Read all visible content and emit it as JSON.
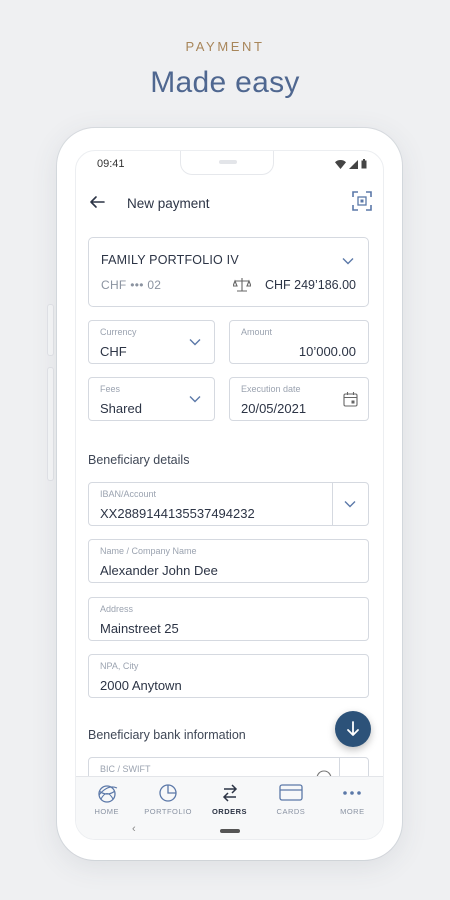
{
  "promo": {
    "eyebrow": "PAYMENT",
    "headline": "Made easy"
  },
  "status_bar": {
    "time": "09:41",
    "icons": [
      "wifi-icon",
      "signal-icon",
      "battery-icon"
    ]
  },
  "header": {
    "title": "New payment",
    "back_icon": "arrow-left-icon",
    "scan_icon": "qr-scan-icon"
  },
  "portfolio": {
    "name": "FAMILY PORTFOLIO IV",
    "account": "CHF ••• 02",
    "balance": "CHF 249’186.00",
    "balance_icon": "scale-icon"
  },
  "form": {
    "currency": {
      "label": "Currency",
      "value": "CHF"
    },
    "amount": {
      "label": "Amount",
      "value": "10’000.00"
    },
    "fees": {
      "label": "Fees",
      "value": "Shared"
    },
    "execution_date": {
      "label": "Execution date",
      "value": "20/05/2021"
    }
  },
  "beneficiary": {
    "section_title": "Beneficiary details",
    "iban": {
      "label": "IBAN/Account",
      "value": "XX2889144135537494232"
    },
    "name": {
      "label": "Name / Company Name",
      "value": "Alexander John Dee"
    },
    "address": {
      "label": "Address",
      "value": "Mainstreet 25"
    },
    "city": {
      "label": "NPA, City",
      "value": "2000 Anytown"
    }
  },
  "bank": {
    "section_title": "Beneficiary bank information",
    "bic": {
      "label": "BIC / SWIFT",
      "value": ""
    }
  },
  "nav": {
    "items": [
      {
        "label": "HOME",
        "icon": "globe-icon"
      },
      {
        "label": "PORTFOLIO",
        "icon": "pie-chart-icon"
      },
      {
        "label": "ORDERS",
        "icon": "transfer-arrows-icon"
      },
      {
        "label": "CARDS",
        "icon": "card-icon"
      },
      {
        "label": "MORE",
        "icon": "more-dots-icon"
      }
    ],
    "active": "ORDERS"
  },
  "colors": {
    "accent_gold": "#a8865a",
    "headline_blue": "#4f6790",
    "fab_blue": "#2c5279",
    "icon_blue": "#5b78a8"
  }
}
